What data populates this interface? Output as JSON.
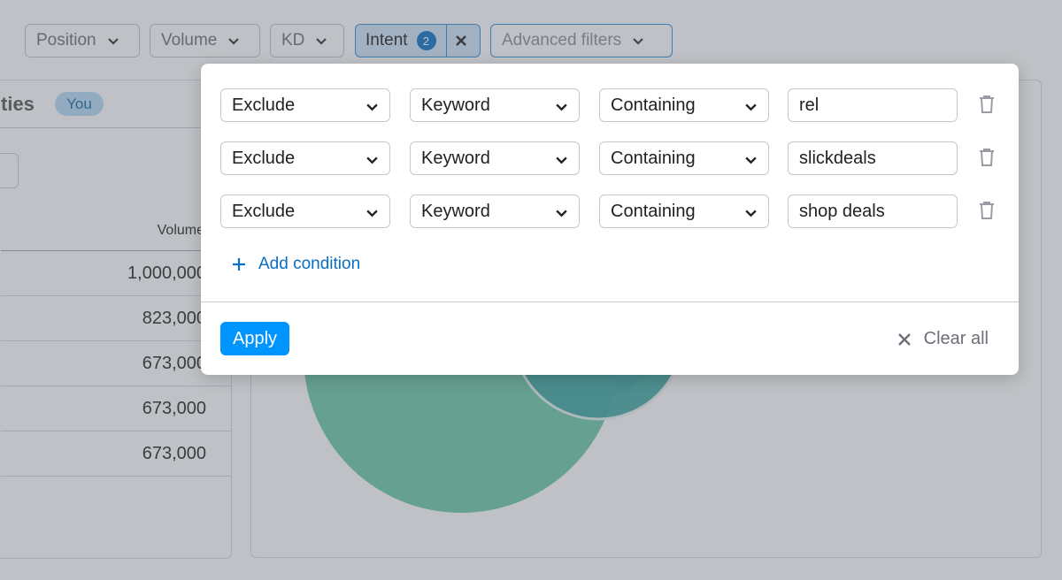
{
  "filter_bar": {
    "chips": [
      {
        "label": "Position",
        "icon": "chevron-down-icon"
      },
      {
        "label": "Volume",
        "icon": "chevron-down-icon"
      },
      {
        "label": "KD",
        "icon": "chevron-down-icon"
      }
    ],
    "intent": {
      "label": "Intent",
      "count": "2",
      "clear_icon": "close-icon"
    },
    "advanced": {
      "label": "Advanced filters",
      "icon": "chevron-down-icon"
    }
  },
  "left_panel": {
    "title_fragment": "ties",
    "you_badge": "You",
    "column_header": "Volume",
    "rows": [
      "1,000,000",
      "823,000",
      "673,000",
      "673,000",
      "673,000"
    ]
  },
  "popup": {
    "conditions": [
      {
        "mode": "Exclude",
        "field": "Keyword",
        "operator": "Containing",
        "value": "rel"
      },
      {
        "mode": "Exclude",
        "field": "Keyword",
        "operator": "Containing",
        "value": "slickdeals"
      },
      {
        "mode": "Exclude",
        "field": "Keyword",
        "operator": "Containing",
        "value": "shop deals"
      }
    ],
    "add_condition": "Add condition",
    "apply": "Apply",
    "clear_all": "Clear all"
  },
  "colors": {
    "accent": "#0094ff",
    "link": "#0a6ec4",
    "overlay": "#606470",
    "venn_green": "#6cc9a7",
    "venn_blue": "#3f8fd6"
  }
}
